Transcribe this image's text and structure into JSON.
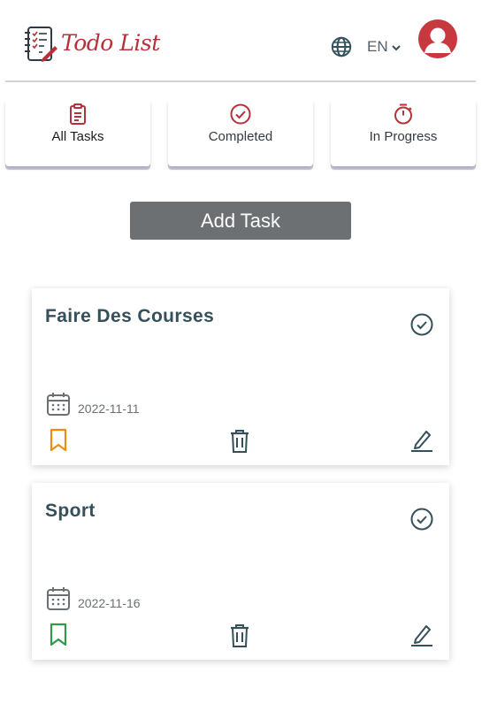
{
  "header": {
    "logo_text": "Todo List",
    "language": "EN"
  },
  "filters": [
    {
      "label": "All Tasks",
      "icon": "clipboard-icon",
      "active": true
    },
    {
      "label": "Completed",
      "icon": "check-circle-icon",
      "active": false
    },
    {
      "label": "In Progress",
      "icon": "stopwatch-icon",
      "active": false
    }
  ],
  "add_task": {
    "label": "Add Task"
  },
  "tasks": [
    {
      "title": "Faire Des Courses",
      "date": "2022-11-11",
      "bookmark_color": "#f28c0f"
    },
    {
      "title": "Sport",
      "date": "2022-11-16",
      "bookmark_color": "#2c9a4b"
    }
  ],
  "colors": {
    "brand": "#b6313a",
    "text_dark": "#34505a",
    "button_gray": "#6d7073"
  }
}
